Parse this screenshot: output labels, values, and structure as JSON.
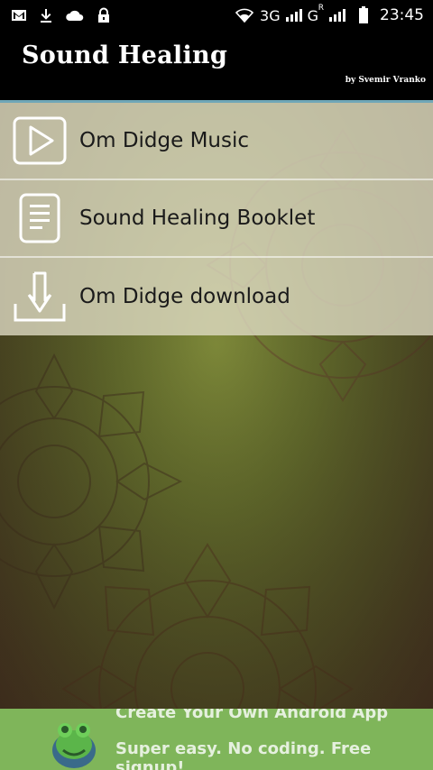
{
  "status_bar": {
    "network_3g": "3G",
    "network_g": "G",
    "roaming": "R",
    "time": "23:45",
    "icons": [
      "gmail-icon",
      "download-icon",
      "cloud-icon",
      "lock-icon",
      "wifi-icon",
      "signal-icon",
      "battery-icon"
    ]
  },
  "app_bar": {
    "title": "Sound Healing",
    "author": "by Svemir Vranko",
    "accent_line_color": "#6fa6b7"
  },
  "menu": {
    "items": [
      {
        "label": "Om Didge Music",
        "icon": "play-icon"
      },
      {
        "label": "Sound Healing Booklet",
        "icon": "document-icon"
      },
      {
        "label": "Om Didge download",
        "icon": "download-tray-icon"
      }
    ]
  },
  "ad_banner": {
    "line1": "Create Your Own Android App",
    "line2": "Super easy. No coding. Free signup!",
    "color": "#7fb55a",
    "icon": "frog-logo-icon"
  }
}
